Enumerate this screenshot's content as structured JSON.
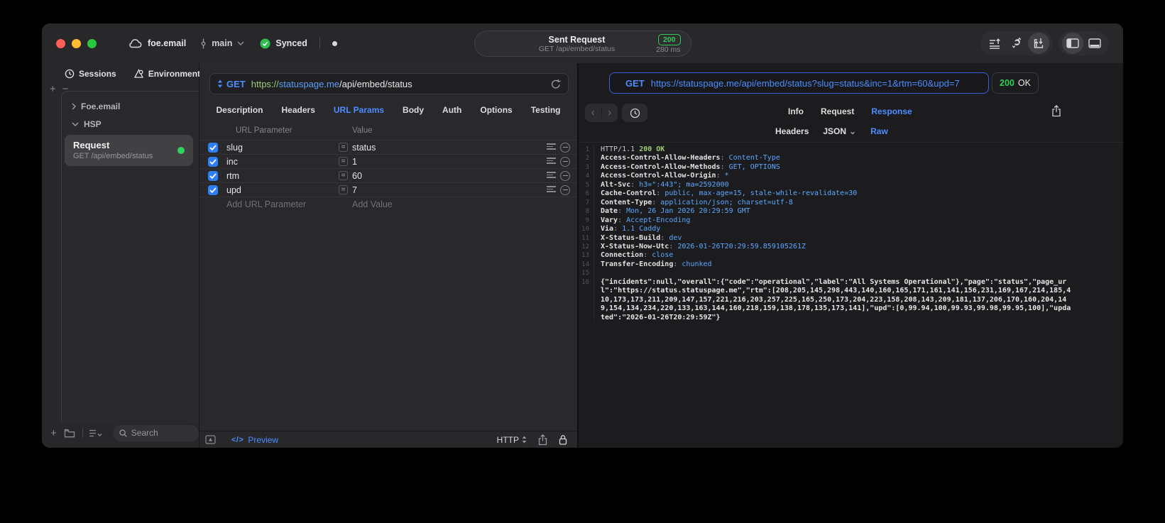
{
  "titlebar": {
    "project": "foe.email",
    "branch": "main",
    "sync_status": "Synced",
    "request_title": "Sent Request",
    "request_subtitle": "GET /api/embed/status",
    "status_code": "200",
    "duration": "280 ms"
  },
  "sidebar": {
    "tabs": [
      {
        "label": "Sessions"
      },
      {
        "label": "Environments"
      }
    ],
    "tree": [
      {
        "label": "Foe.email"
      },
      {
        "label": "HSP"
      }
    ],
    "request_item": {
      "title": "Request",
      "subtitle": "GET /api/embed/status"
    },
    "search_placeholder": "Search"
  },
  "request_panel": {
    "method": "GET",
    "url": {
      "scheme": "https://",
      "host": "statuspage.me",
      "path": "/api/embed/status"
    },
    "tabs": [
      "Description",
      "Headers",
      "URL Params",
      "Body",
      "Auth",
      "Options",
      "Testing"
    ],
    "active_tab": "URL Params",
    "param_table": {
      "columns": [
        "URL Parameter",
        "Value"
      ],
      "rows": [
        {
          "name": "slug",
          "value": "status",
          "enabled": true
        },
        {
          "name": "inc",
          "value": "1",
          "enabled": true
        },
        {
          "name": "rtm",
          "value": "60",
          "enabled": true
        },
        {
          "name": "upd",
          "value": "7",
          "enabled": true
        }
      ],
      "add_name_placeholder": "Add URL Parameter",
      "add_value_placeholder": "Add Value"
    },
    "footer": {
      "preview_code": "</>",
      "preview_label": "Preview",
      "protocol_label": "HTTP"
    }
  },
  "response_panel": {
    "method": "GET",
    "url": "https://statuspage.me/api/embed/status?slug=status&inc=1&rtm=60&upd=7",
    "status_code": "200",
    "status_text": "OK",
    "tabs": [
      "Info",
      "Request",
      "Response"
    ],
    "active_tab": "Response",
    "subtabs": [
      "Headers",
      "JSON",
      "Raw"
    ],
    "active_subtab": "Raw",
    "raw": {
      "status_line": {
        "protocol": "HTTP/1.1",
        "status": "200 OK"
      },
      "headers": [
        {
          "name": "Access-Control-Allow-Headers",
          "value": "Content-Type"
        },
        {
          "name": "Access-Control-Allow-Methods",
          "value": "GET, OPTIONS"
        },
        {
          "name": "Access-Control-Allow-Origin",
          "value": "*"
        },
        {
          "name": "Alt-Svc",
          "value": "h3=\":443\"; ma=2592000"
        },
        {
          "name": "Cache-Control",
          "value": "public, max-age=15, stale-while-revalidate=30"
        },
        {
          "name": "Content-Type",
          "value": "application/json; charset=utf-8"
        },
        {
          "name": "Date",
          "value": "Mon, 26 Jan 2026 20:29:59 GMT"
        },
        {
          "name": "Vary",
          "value": "Accept-Encoding"
        },
        {
          "name": "Via",
          "value": "1.1 Caddy"
        },
        {
          "name": "X-Status-Build",
          "value": "dev"
        },
        {
          "name": "X-Status-Now-Utc",
          "value": "2026-01-26T20:29:59.859105261Z"
        },
        {
          "name": "Connection",
          "value": "close"
        },
        {
          "name": "Transfer-Encoding",
          "value": "chunked"
        }
      ],
      "body": "{\"incidents\":null,\"overall\":{\"code\":\"operational\",\"label\":\"All Systems Operational\"},\"page\":\"status\",\"page_url\":\"https://status.statuspage.me\",\"rtm\":[208,205,145,298,443,140,160,165,171,161,141,156,231,169,167,214,185,410,173,173,211,209,147,157,221,216,203,257,225,165,250,173,204,223,158,208,143,209,181,137,206,170,160,204,149,154,134,234,220,133,163,144,160,218,159,138,178,135,173,141],\"upd\":[0,99.94,100,99.93,99.98,99.95,100],\"updated\":\"2026-01-26T20:29:59Z\"}"
    }
  },
  "colors": {
    "accent_blue": "#4C8DFF",
    "status_green": "#32D158",
    "badge_green": "#34C759",
    "code_value_blue": "#5CA8FF",
    "code_status_green": "#9CCB73",
    "url_scheme_green": "#9CCB7A",
    "checkbox_blue": "#2D7FF9"
  }
}
